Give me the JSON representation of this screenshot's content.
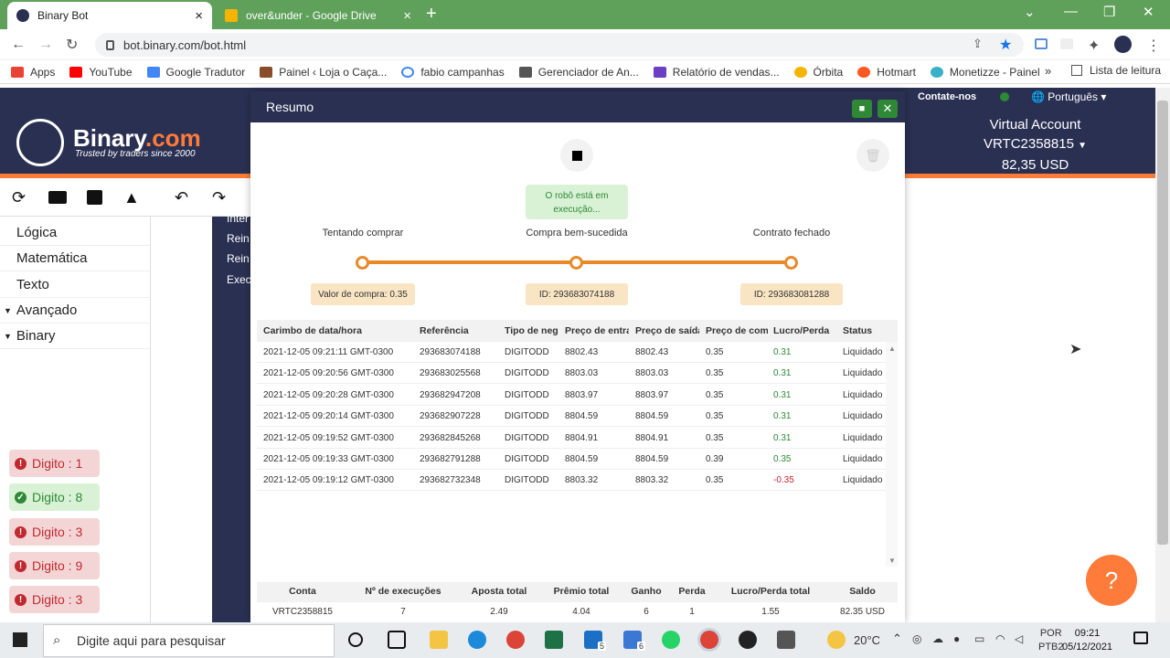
{
  "browser": {
    "tabs": [
      {
        "title": "Binary Bot",
        "active": true
      },
      {
        "title": "over&under - Google Drive",
        "active": false
      }
    ],
    "url": "bot.binary.com/bot.html",
    "bookmarks": [
      "Apps",
      "YouTube",
      "Google Tradutor",
      "Painel ‹ Loja o Caça...",
      "fabio campanhas",
      "Gerenciador de An...",
      "Relatório de vendas...",
      "Órbita",
      "Hotmart",
      "Monetizze - Painel"
    ],
    "more_bookmarks": "»",
    "reading_list": "Lista de leitura"
  },
  "site": {
    "logo_name": "Binary",
    "logo_tld": ".com",
    "logo_tagline": "Trusted by traders since 2000",
    "contact": "Contate-nos",
    "language": "Português",
    "account_label": "Virtual Account",
    "account_id": "VRTC2358815",
    "balance": "82,35 USD"
  },
  "sidebar": {
    "categories": [
      "Lógica",
      "Matemática",
      "Texto",
      "Avançado",
      "Binary"
    ]
  },
  "workspace_labels": [
    "Inter",
    "Rein",
    "Rein",
    "Exec"
  ],
  "digits": [
    {
      "label": "Digito : 1",
      "status": "bad"
    },
    {
      "label": "Digito : 8",
      "status": "good"
    },
    {
      "label": "Digito : 3",
      "status": "bad"
    },
    {
      "label": "Digito : 9",
      "status": "bad"
    },
    {
      "label": "Digito : 3",
      "status": "bad"
    }
  ],
  "modal": {
    "title": "Resumo",
    "status": "O robô está em execução...",
    "steps": [
      "Tentando comprar",
      "Compra bem-sucedida",
      "Contrato fechado"
    ],
    "step_boxes": [
      "Valor de compra: 0.35",
      "ID: 293683074188",
      "ID: 293683081288"
    ],
    "columns": [
      "Carimbo de data/hora",
      "Referência",
      "Tipo de neg",
      "Preço de entra",
      "Preço de saída",
      "Preço de com",
      "Lucro/Perda",
      "Status"
    ],
    "rows": [
      [
        "2021-12-05 09:21:11 GMT-0300",
        "293683074188",
        "DIGITODD",
        "8802.43",
        "8802.43",
        "0.35",
        "0.31",
        "Liquidado"
      ],
      [
        "2021-12-05 09:20:56 GMT-0300",
        "293683025568",
        "DIGITODD",
        "8803.03",
        "8803.03",
        "0.35",
        "0.31",
        "Liquidado"
      ],
      [
        "2021-12-05 09:20:28 GMT-0300",
        "293682947208",
        "DIGITODD",
        "8803.97",
        "8803.97",
        "0.35",
        "0.31",
        "Liquidado"
      ],
      [
        "2021-12-05 09:20:14 GMT-0300",
        "293682907228",
        "DIGITODD",
        "8804.59",
        "8804.59",
        "0.35",
        "0.31",
        "Liquidado"
      ],
      [
        "2021-12-05 09:19:52 GMT-0300",
        "293682845268",
        "DIGITODD",
        "8804.91",
        "8804.91",
        "0.35",
        "0.31",
        "Liquidado"
      ],
      [
        "2021-12-05 09:19:33 GMT-0300",
        "293682791288",
        "DIGITODD",
        "8804.59",
        "8804.59",
        "0.39",
        "0.35",
        "Liquidado"
      ],
      [
        "2021-12-05 09:19:12 GMT-0300",
        "293682732348",
        "DIGITODD",
        "8803.32",
        "8803.32",
        "0.35",
        "-0.35",
        "Liquidado"
      ]
    ],
    "summary_headers": [
      "Conta",
      "Nº de execuções",
      "Aposta total",
      "Prêmio total",
      "Ganho",
      "Perda",
      "Lucro/Perda total",
      "Saldo"
    ],
    "summary_values": [
      "VRTC2358815",
      "7",
      "2.49",
      "4.04",
      "6",
      "1",
      "1.55",
      "82.35 USD"
    ]
  },
  "taskbar": {
    "search_placeholder": "Digite aqui para pesquisar",
    "weather": "20°C",
    "lang_top": "POR",
    "lang_bottom": "PTB2",
    "time": "09:21",
    "date": "05/12/2021",
    "badges": [
      "5",
      "6"
    ]
  },
  "colors": {
    "brand": "#2a3052",
    "accent": "#ff7b3a",
    "positive": "#2e8836",
    "negative": "#c0292f"
  }
}
